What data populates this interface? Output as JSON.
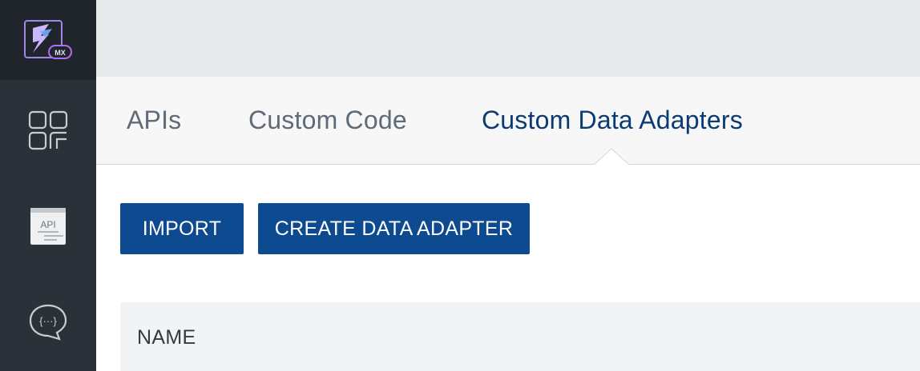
{
  "app": {
    "logo_badge": "MX",
    "icons": [
      "logo-icon",
      "apps-grid-icon",
      "api-icon",
      "chat-code-icon"
    ]
  },
  "tabs": [
    {
      "label": "APIs",
      "active": false
    },
    {
      "label": "Custom Code",
      "active": false
    },
    {
      "label": "Custom Data Adapters",
      "active": true
    }
  ],
  "toolbar": {
    "import_label": "IMPORT",
    "create_label": "CREATE DATA ADAPTER"
  },
  "table": {
    "columns": [
      "NAME"
    ]
  },
  "colors": {
    "sidebar": "#2a3138",
    "sidebar_logo_bg": "#1f252b",
    "accent": "#0d4a8f",
    "active_tab_text": "#0b3b70",
    "inactive_tab_text": "#5f6b77"
  },
  "side_icon_labels": {
    "api": "API",
    "chat": "{···}"
  }
}
